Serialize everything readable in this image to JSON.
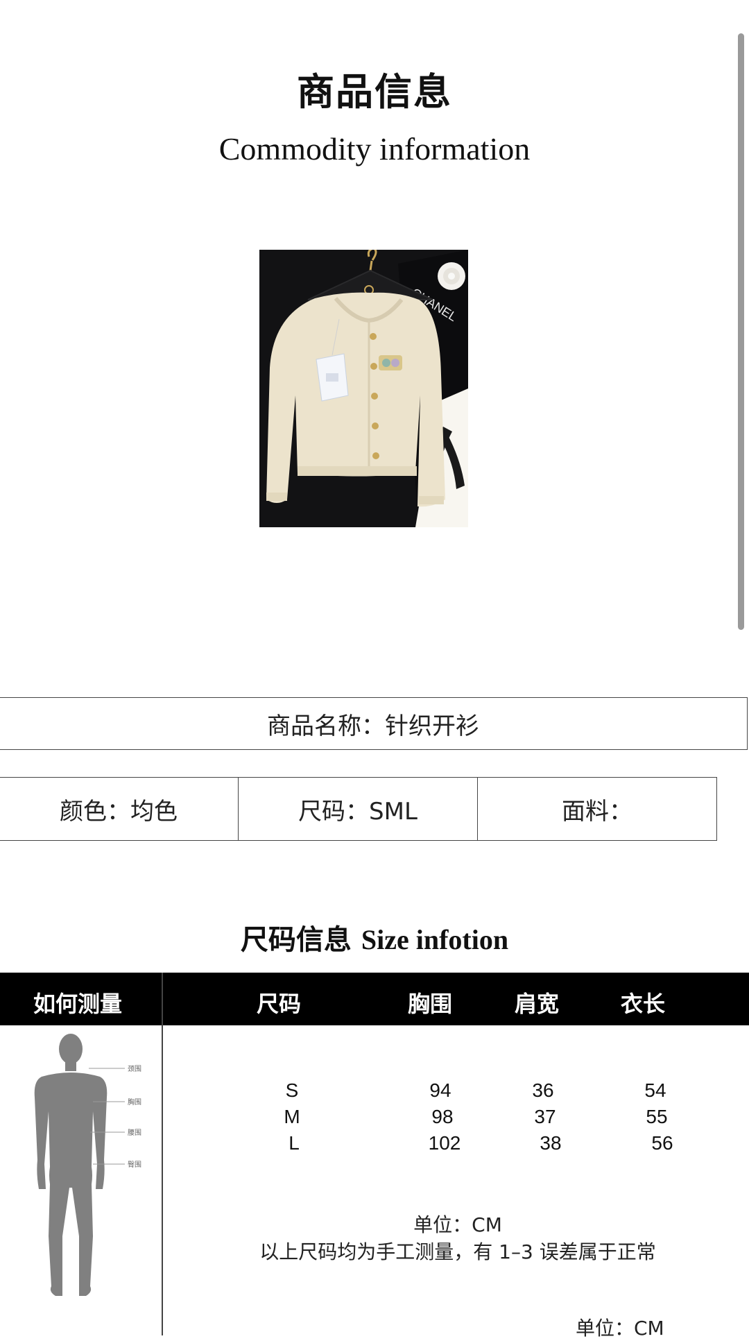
{
  "header": {
    "title_cn": "商品信息",
    "title_en": "Commodity information"
  },
  "product_image": {
    "brand_tag_text": "CHANEL",
    "colors": {
      "cardigan": "#ece3cc",
      "background": "#121214",
      "box": "#f8f6f0"
    }
  },
  "info": {
    "name": "商品名称：针织开衫",
    "color": "颜色：均色",
    "size": "尺码：SML",
    "fabric": "面料："
  },
  "size_section": {
    "title_cn": "尺码信息",
    "title_en": "Size infotion",
    "headers": [
      "如何测量",
      "尺码",
      "胸围",
      "肩宽",
      "衣长"
    ],
    "figure_labels": [
      "颈围",
      "胸围",
      "腰围",
      "臀围"
    ],
    "rows": [
      {
        "size": "S",
        "chest": "94",
        "shoulder": "36",
        "length": "54"
      },
      {
        "size": "M",
        "chest": "98",
        "shoulder": "37",
        "length": "55"
      },
      {
        "size": "L",
        "chest": "102",
        "shoulder": "38",
        "length": "56"
      }
    ],
    "unit": "单位：CM",
    "note": "以上尺码均为手工测量，有 1–3 误差属于正常",
    "unit_bottom": "单位：CM"
  }
}
